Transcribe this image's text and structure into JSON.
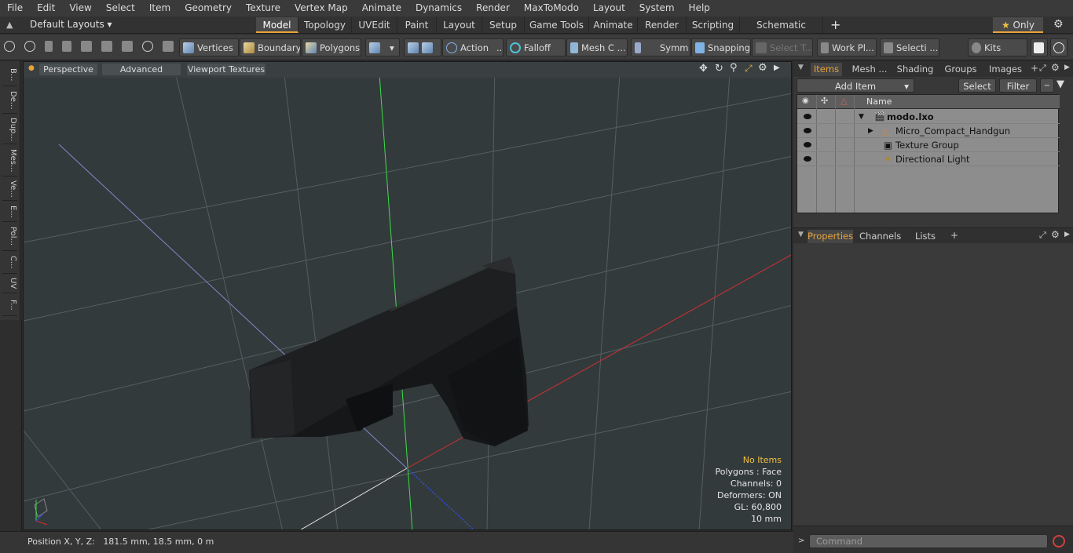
{
  "menu": [
    "File",
    "Edit",
    "View",
    "Select",
    "Item",
    "Geometry",
    "Texture",
    "Vertex Map",
    "Animate",
    "Dynamics",
    "Render",
    "MaxToModo",
    "Layout",
    "System",
    "Help"
  ],
  "layout_selector": "Default Layouts",
  "workspace_tabs": [
    "Model",
    "Topology",
    "UVEdit",
    "Paint",
    "Layout",
    "Setup",
    "Game Tools",
    "Animate",
    "Render",
    "Scripting",
    "Schematic Fusion"
  ],
  "only_label": "Only",
  "toolbar": {
    "vertices": "Vertices",
    "boundary": "Boundary",
    "polygons": "Polygons",
    "action": "Action",
    "falloff": "Falloff",
    "mesh": "Mesh C ...",
    "symm": "Symm ...",
    "snapping": "Snapping",
    "select_t": "Select T...",
    "work_pl": "Work Pl...",
    "selecti": "Selecti ...",
    "kits": "Kits"
  },
  "left_tabs": [
    "B...",
    "De...",
    "Dup...",
    "Mes...",
    "Ve...",
    "E...",
    "Pol...",
    "C...",
    "UV",
    "F..."
  ],
  "viewport": {
    "perspective": "Perspective",
    "advanced": "Advanced",
    "viewport_textures": "Viewport Textures",
    "stats": {
      "no_items": "No Items",
      "polygons": "Polygons : Face",
      "channels": "Channels: 0",
      "deformers": "Deformers: ON",
      "gl": "GL: 60,800",
      "scale": "10 mm"
    }
  },
  "status": {
    "label": "Position X, Y, Z:",
    "value": "181.5 mm, 18.5 mm, 0 m"
  },
  "items_panel": {
    "tabs": [
      "Items",
      "Mesh ...",
      "Shading",
      "Groups",
      "Images"
    ],
    "add_item": "Add Item",
    "select": "Select",
    "filter": "Filter",
    "name_header": "Name",
    "rows": [
      "modo.lxo",
      "Micro_Compact_Handgun",
      "Texture Group",
      "Directional Light"
    ]
  },
  "properties_panel": {
    "tabs": [
      "Properties",
      "Channels",
      "Lists"
    ]
  },
  "command_placeholder": "Command",
  "colors": {
    "accent": "#e8a33b",
    "axis_x": "#d03030",
    "axis_y": "#30d040",
    "axis_z": "#3050e0",
    "viewport_bg": "#333a3c"
  }
}
